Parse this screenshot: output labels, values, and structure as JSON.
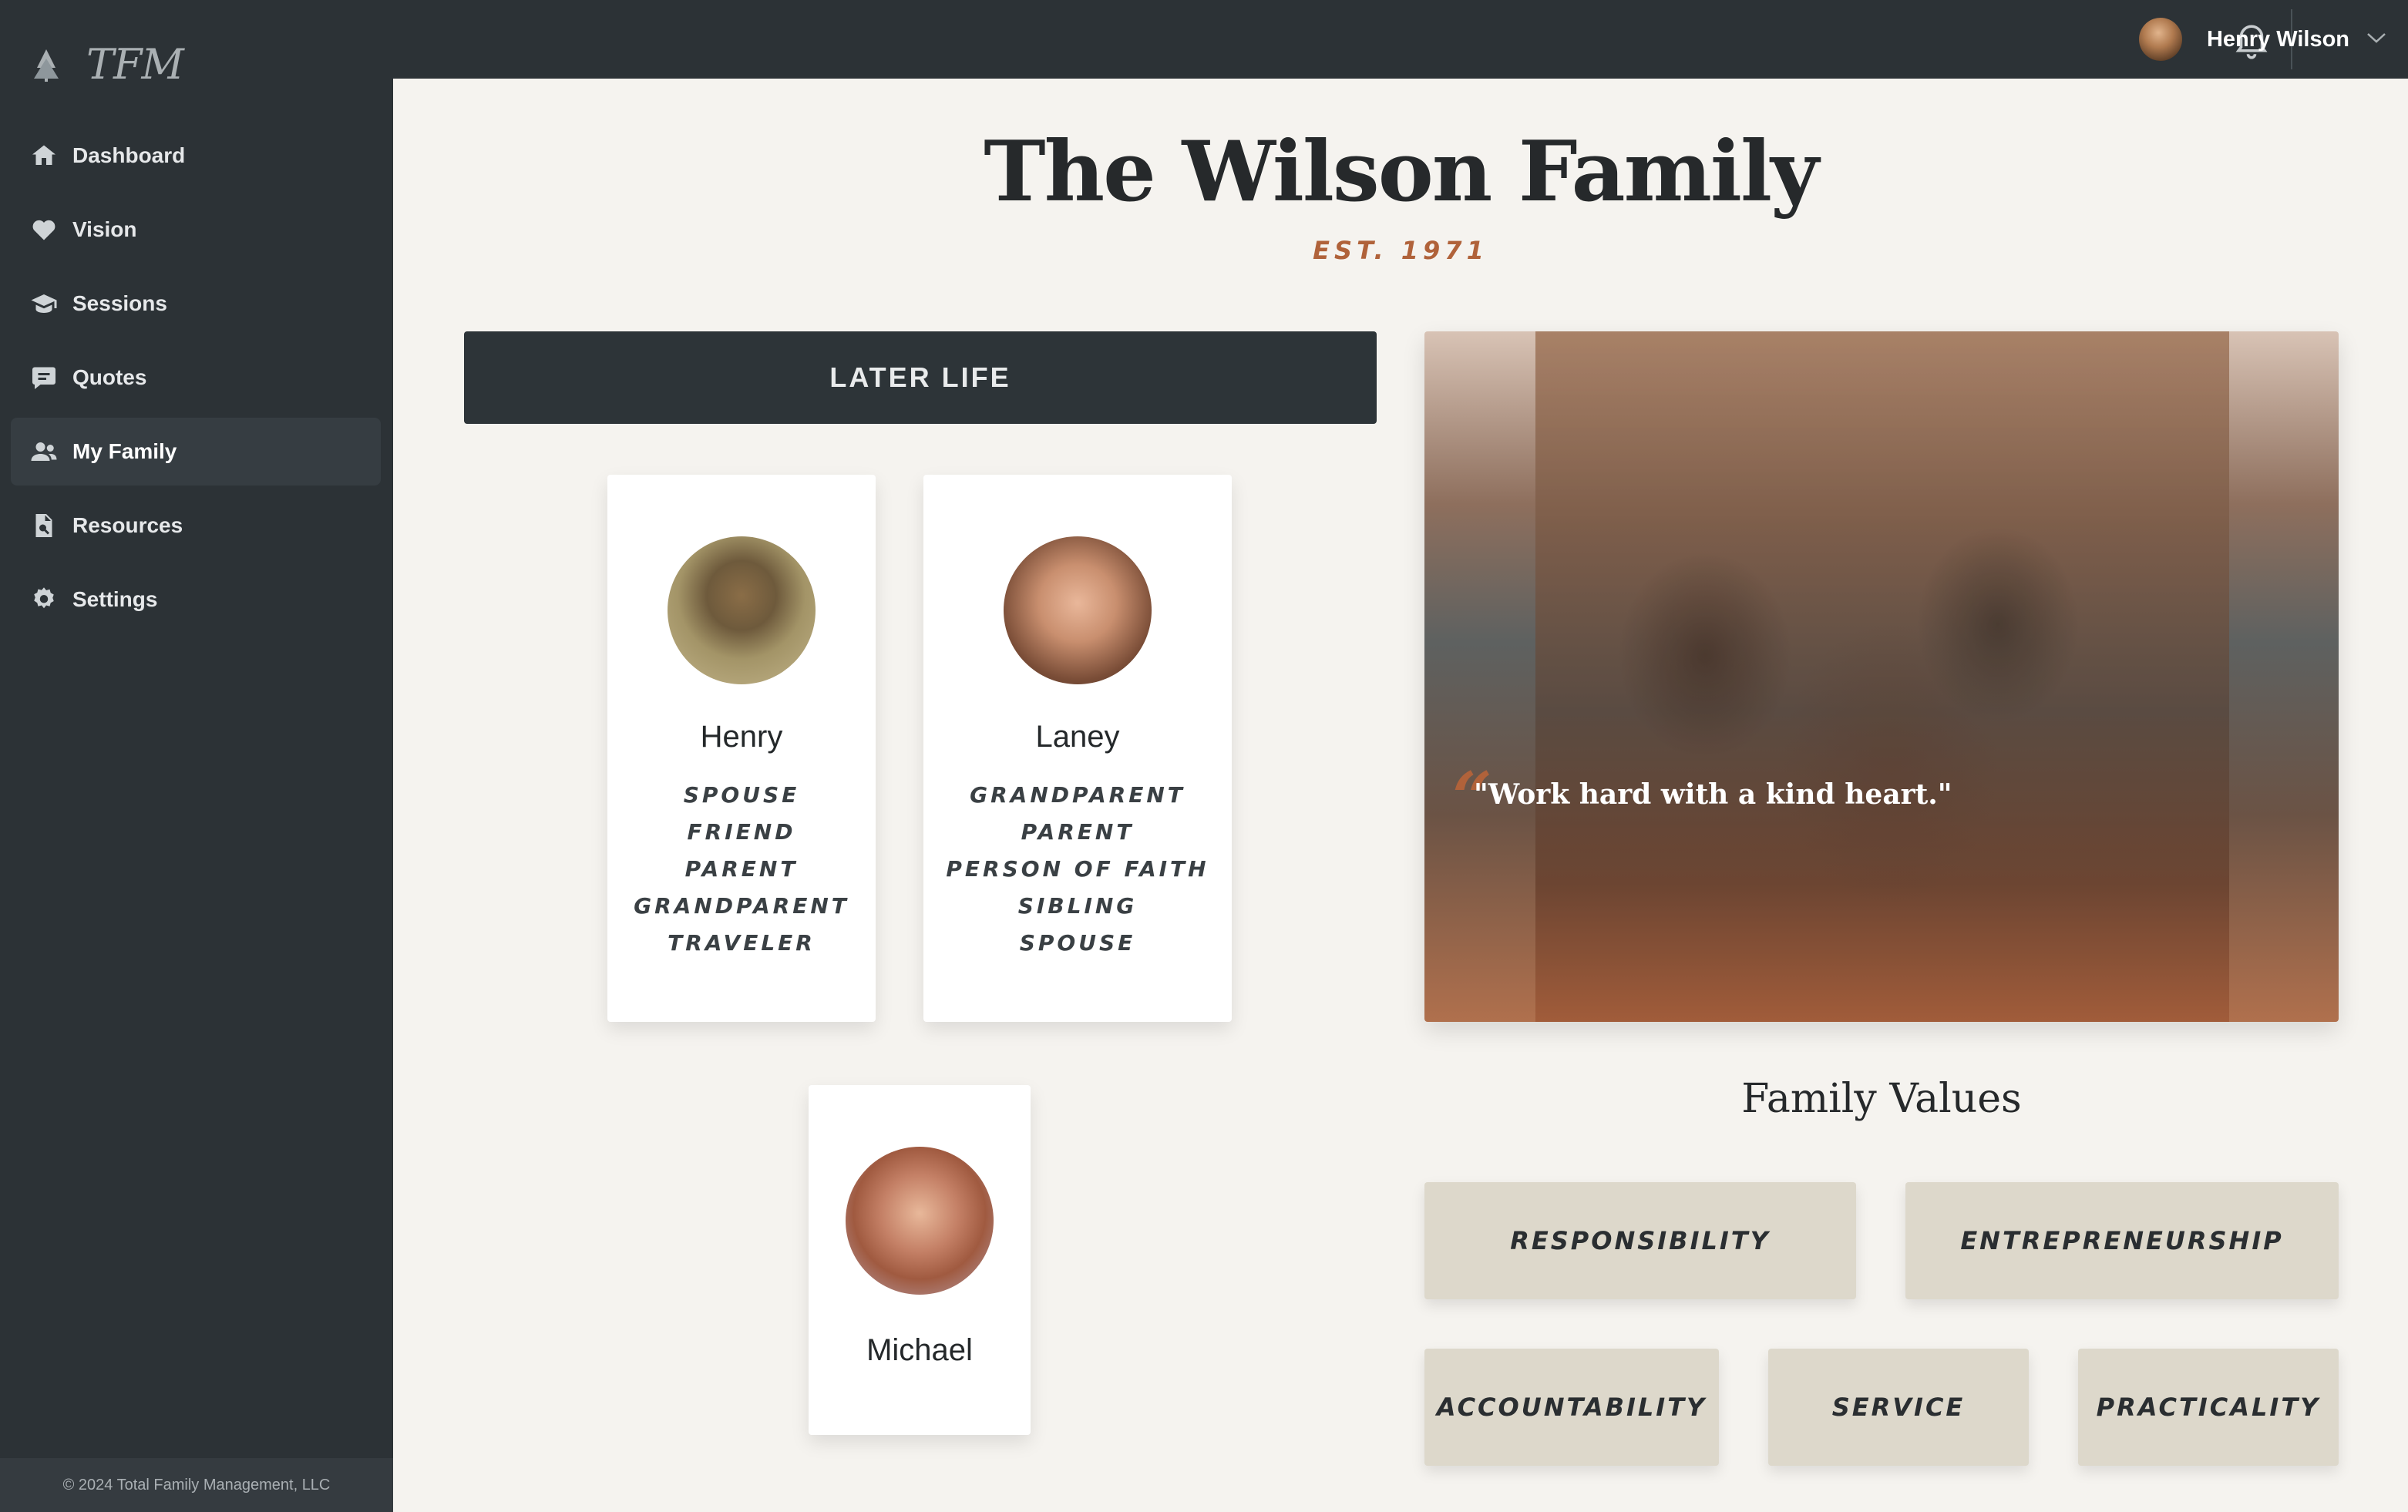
{
  "brand": {
    "logo_text": "TFM",
    "logo_icon": "pine-tree-icon"
  },
  "sidebar": {
    "items": [
      {
        "label": "Dashboard",
        "icon": "home-icon",
        "active": false
      },
      {
        "label": "Vision",
        "icon": "heart-icon",
        "active": false
      },
      {
        "label": "Sessions",
        "icon": "graduation-cap-icon",
        "active": false
      },
      {
        "label": "Quotes",
        "icon": "comment-icon",
        "active": false
      },
      {
        "label": "My Family",
        "icon": "users-icon",
        "active": true
      },
      {
        "label": "Resources",
        "icon": "file-search-icon",
        "active": false
      },
      {
        "label": "Settings",
        "icon": "gear-icon",
        "active": false
      }
    ],
    "footer": "© 2024 Total Family Management, LLC"
  },
  "topbar": {
    "notification_icon": "bell-icon",
    "user_name": "Henry Wilson",
    "dropdown_icon": "chevron-down-icon"
  },
  "page": {
    "title": "The Wilson Family",
    "established": "EST. 1971",
    "section_button": "LATER LIFE"
  },
  "members": [
    {
      "name": "Henry",
      "roles": [
        "SPOUSE",
        "FRIEND",
        "PARENT",
        "GRANDPARENT",
        "TRAVELER"
      ]
    },
    {
      "name": "Laney",
      "roles": [
        "GRANDPARENT",
        "PARENT",
        "PERSON OF FAITH",
        "SIBLING",
        "SPOUSE"
      ]
    },
    {
      "name": "Michael",
      "roles": []
    }
  ],
  "feature": {
    "quote": "\"Work hard with a kind heart.\"",
    "quote_mark": "“"
  },
  "values": {
    "title": "Family Values",
    "items": [
      "RESPONSIBILITY",
      "ENTREPRENEURSHIP",
      "ACCOUNTABILITY",
      "SERVICE",
      "PRACTICALITY"
    ]
  },
  "colors": {
    "sidebar_bg": "#2c3236",
    "page_bg": "#f5f3ef",
    "accent": "#b0623a",
    "value_tile": "#ddd8cb"
  }
}
